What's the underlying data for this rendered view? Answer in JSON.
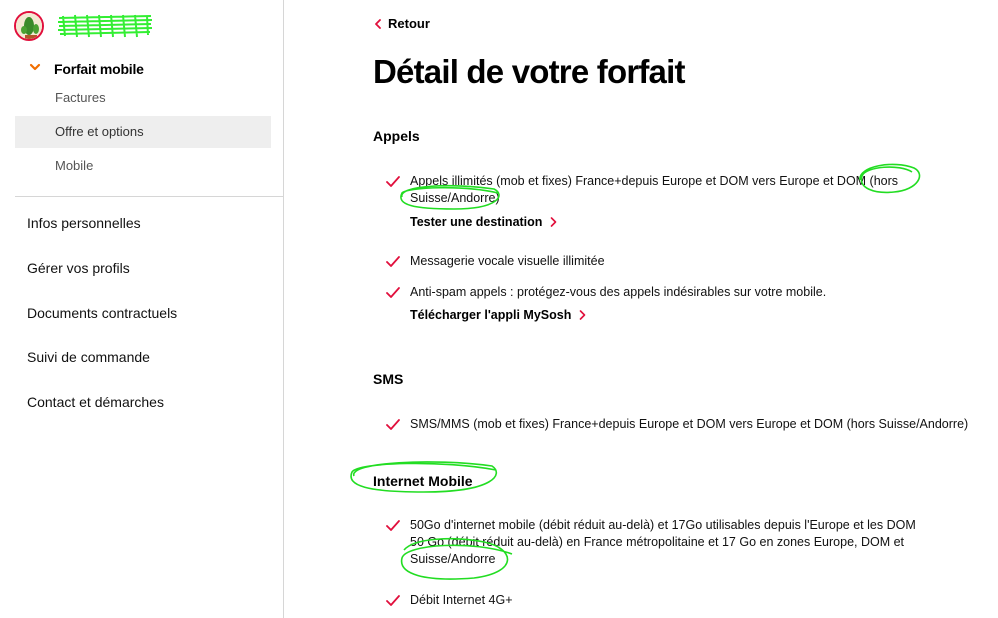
{
  "sidebar": {
    "username": "",
    "nav_parent": "Forfait mobile",
    "sub_items": [
      "Factures",
      "Offre et options",
      "Mobile"
    ],
    "main_items": [
      "Infos personnelles",
      "Gérer vos profils",
      "Documents contractuels",
      "Suivi de commande",
      "Contact et démarches"
    ]
  },
  "main": {
    "back_label": "Retour",
    "title": "Détail de votre forfait",
    "sections": {
      "appels": {
        "title": "Appels",
        "items": [
          "Appels illimités (mob et fixes) France+depuis Europe et DOM vers Europe et DOM (hors Suisse/Andorre)",
          "Messagerie vocale visuelle illimitée",
          "Anti-spam appels : protégez-vous des appels indésirables sur votre mobile."
        ],
        "links": [
          "Tester une destination",
          "Télécharger l'appli MySosh"
        ]
      },
      "sms": {
        "title": "SMS",
        "items": [
          "SMS/MMS (mob et fixes) France+depuis Europe et DOM vers Europe et DOM (hors Suisse/Andorre)"
        ]
      },
      "internet": {
        "title": "Internet Mobile",
        "items": [
          "50Go d'internet mobile (débit réduit au-delà) et 17Go utilisables depuis l'Europe et les DOM 50 Go (débit réduit au-delà) en France métropolitaine et 17 Go en zones Europe, DOM et Suisse/Andorre",
          "Débit Internet 4G+"
        ]
      }
    }
  },
  "colors": {
    "accent": "#e10f3c",
    "chevron_orange": "#f16e00",
    "highlight_green": "#22dd22",
    "sidebar_active_bg": "#eeeeee"
  },
  "icons": {
    "back": "chevron-left-icon",
    "check": "check-icon",
    "expand": "chevron-down-icon",
    "link": "chevron-right-icon"
  }
}
